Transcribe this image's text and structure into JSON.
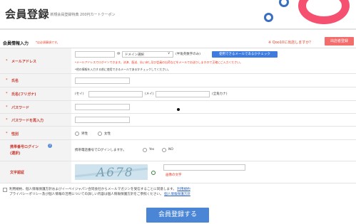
{
  "header": {
    "title": "会員登録",
    "subtitle": "- 新規会員登録特典 200円カートクーポン"
  },
  "section": {
    "title": "会員情報入力",
    "required_note": "*は必須事項です。",
    "qoo10_note": "※ Qoo10に出店しますか？",
    "shop_button": "出店者登録"
  },
  "email": {
    "label": "メールアドレス",
    "at": "@",
    "domain_select": "ドメイン選択",
    "half_width_note": "(半角英数字のみ)",
    "check_button": "使用できるメールであるかチェック",
    "notice_red": "*メールアドレスでログインできます。決済、配送、払い戻し及び会員の出荷などをメールでお送りしますので正確にご入力ください。",
    "notice_gray": "*他の情報を入力する前に使用できるメールであるかチェックしてください。"
  },
  "name": {
    "label": "氏名"
  },
  "kana": {
    "label": "氏名(フリガナ)",
    "sei": "(セイ)",
    "mei": "(メイ)",
    "fullkana": "(全角カナ)"
  },
  "password": {
    "label": "パスワード"
  },
  "password_confirm": {
    "label": "パスワードを再入力"
  },
  "gender": {
    "label": "性別",
    "male": "男性",
    "female": "女性"
  },
  "mobile_login": {
    "label1": "携帯番号ログイン",
    "label2": "(選択)",
    "question": "携帯電話番号でログインしますか。",
    "yes": "Yes",
    "no": "NO"
  },
  "captcha": {
    "label": "文字認証",
    "image_text": "A678",
    "input_note": "画像の文字"
  },
  "agreement": {
    "line1": "利用規約、個人情報保護方針およびイーベイジャパン合同会社からメールマガジンを受信することに同意します。",
    "terms_link": "利用規約",
    "line2": "プライバシーポリシー及び個人情報の活用についての詳しい内容は個人情報保護方針をご参照ください。",
    "privacy_link": "個人情報保護方針"
  },
  "submit_label": "会員登録する",
  "colors": {
    "accent_blue": "#3d7be0",
    "accent_red": "#e8381e",
    "brand_pink": "#f5506f"
  }
}
